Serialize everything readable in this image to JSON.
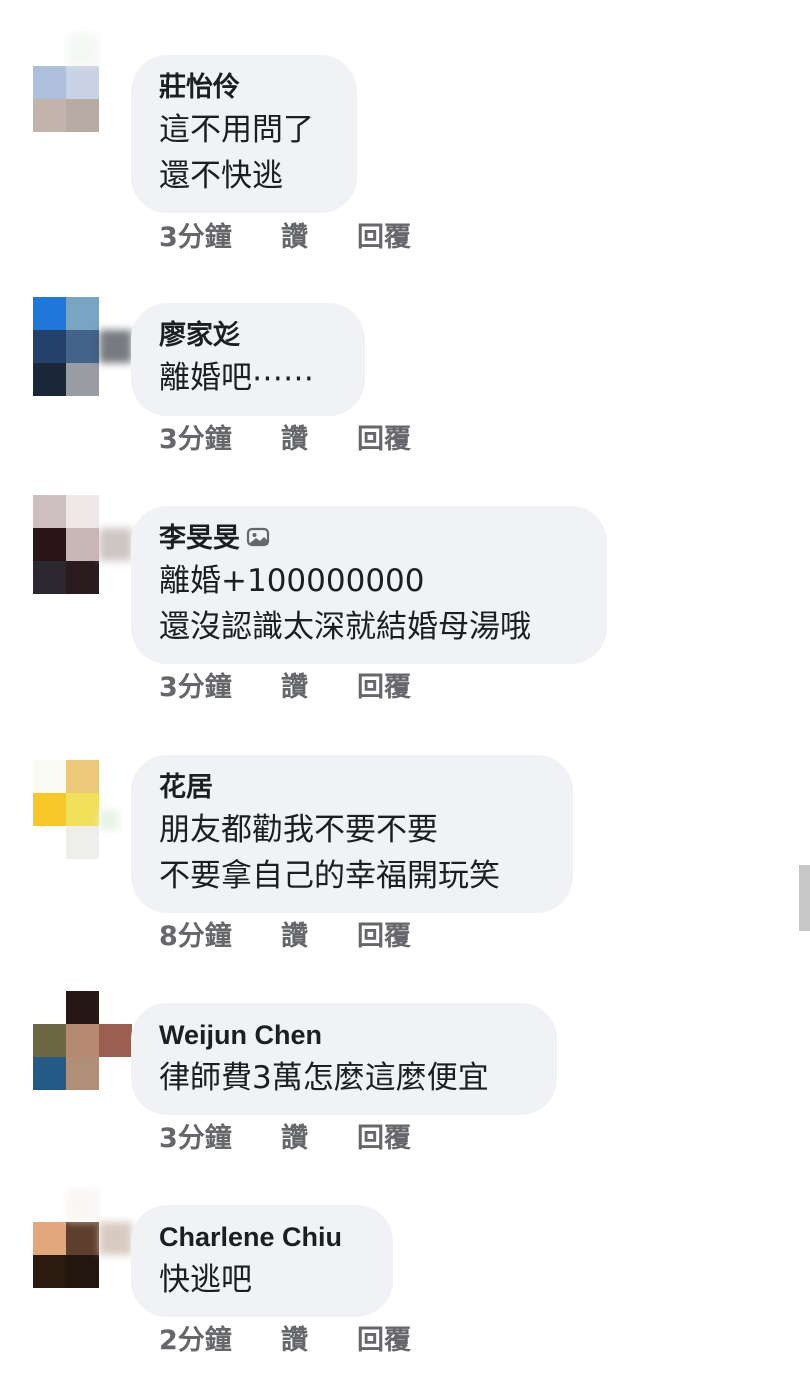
{
  "comments": [
    {
      "author": "莊怡伶",
      "lines": [
        "這不用問了",
        "還不快逃"
      ],
      "time": "3分鐘",
      "like": "讚",
      "reply": "回覆"
    },
    {
      "author": "廖家彣",
      "lines": [
        "離婚吧⋯⋯"
      ],
      "time": "3分鐘",
      "like": "讚",
      "reply": "回覆"
    },
    {
      "author": "李旻旻",
      "badge_icon": "sticker-comment-icon",
      "lines": [
        "離婚+100000000",
        "還沒認識太深就結婚母湯哦"
      ],
      "time": "3分鐘",
      "like": "讚",
      "reply": "回覆"
    },
    {
      "author": "花居",
      "lines": [
        "朋友都勸我不要不要",
        "不要拿自己的幸福開玩笑"
      ],
      "time": "8分鐘",
      "like": "讚",
      "reply": "回覆"
    },
    {
      "author": "Weijun Chen",
      "lines": [
        "律師費3萬怎麼這麼便宜"
      ],
      "time": "3分鐘",
      "like": "讚",
      "reply": "回覆"
    },
    {
      "author": "Charlene Chiu",
      "lines": [
        "快逃吧"
      ],
      "time": "2分鐘",
      "like": "讚",
      "reply": "回覆"
    }
  ],
  "colors": {
    "bubble": "#f0f2f5",
    "text": "#1c1e21",
    "meta": "#65676b",
    "scrollbar": "#c7c7c7"
  }
}
